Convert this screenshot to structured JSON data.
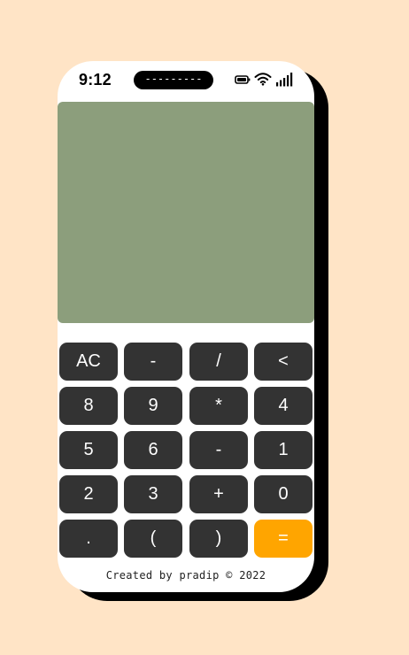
{
  "status_bar": {
    "time": "9:12",
    "notch_text": "---------",
    "icons": [
      "battery-icon",
      "wifi-icon",
      "signal-icon"
    ]
  },
  "display": {
    "value": "",
    "background_color": "#8C9E7C"
  },
  "keypad": {
    "keys": [
      {
        "label": "AC",
        "name": "key-ac"
      },
      {
        "label": "-",
        "name": "key-minus-top"
      },
      {
        "label": "/",
        "name": "key-divide"
      },
      {
        "label": "<",
        "name": "key-backspace"
      },
      {
        "label": "8",
        "name": "key-8"
      },
      {
        "label": "9",
        "name": "key-9"
      },
      {
        "label": "*",
        "name": "key-multiply"
      },
      {
        "label": "4",
        "name": "key-4"
      },
      {
        "label": "5",
        "name": "key-5"
      },
      {
        "label": "6",
        "name": "key-6"
      },
      {
        "label": "-",
        "name": "key-minus"
      },
      {
        "label": "1",
        "name": "key-1"
      },
      {
        "label": "2",
        "name": "key-2"
      },
      {
        "label": "3",
        "name": "key-3"
      },
      {
        "label": "+",
        "name": "key-plus"
      },
      {
        "label": "0",
        "name": "key-0"
      },
      {
        "label": ".",
        "name": "key-decimal"
      },
      {
        "label": "(",
        "name": "key-open-paren"
      },
      {
        "label": ")",
        "name": "key-close-paren"
      },
      {
        "label": "=",
        "name": "key-equals"
      }
    ],
    "key_color": "#333333",
    "equals_color": "#FFA500"
  },
  "footer": {
    "text": "Created by pradip © 2022"
  },
  "colors": {
    "page_background": "#FFE4C6",
    "phone_body": "#FFFFFF",
    "phone_shadow": "#000000"
  }
}
